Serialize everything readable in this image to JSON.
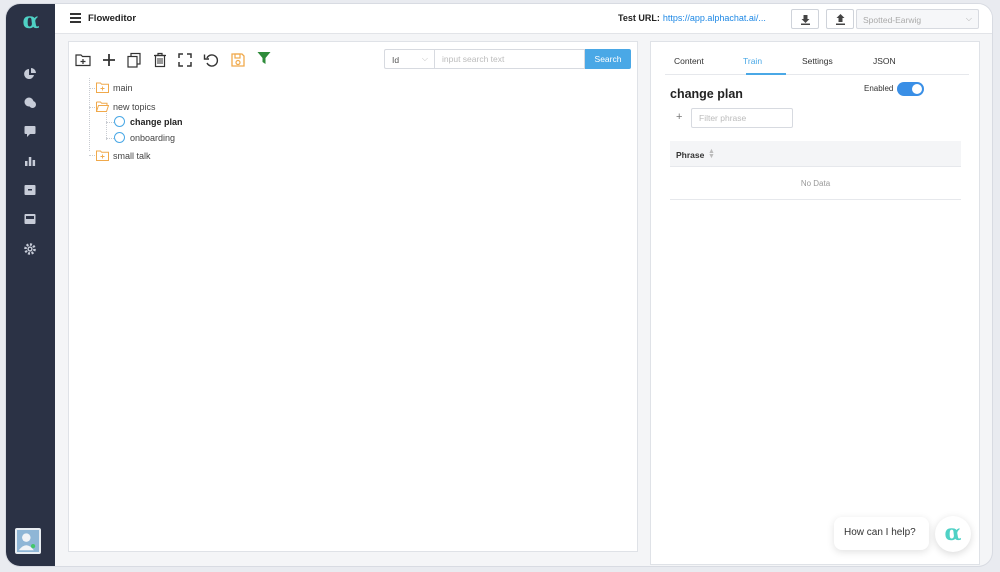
{
  "app": {
    "logo": "α",
    "title": "Floweditor"
  },
  "topbar": {
    "test_url_label": "Test URL:",
    "test_url_value": "https://app.alphachat.ai/...",
    "download_icon": "download-icon",
    "upload_icon": "upload-icon",
    "bot_select_value": "Spotted-Earwig"
  },
  "sidebar": {
    "items": [
      {
        "icon": "analytics-icon"
      },
      {
        "icon": "chat-icon"
      },
      {
        "icon": "message-icon"
      },
      {
        "icon": "bar-chart-icon"
      },
      {
        "icon": "archive-icon"
      },
      {
        "icon": "inbox-icon"
      },
      {
        "icon": "gear-icon"
      }
    ],
    "avatar_icon": "user-avatar-icon"
  },
  "toolbar": {
    "icons": [
      "new-folder-icon",
      "add-icon",
      "copy-icon",
      "trash-icon",
      "fullscreen-icon",
      "undo-icon",
      "save-icon",
      "filter-icon"
    ]
  },
  "search": {
    "type_value": "Id",
    "placeholder": "input search text",
    "button_label": "Search"
  },
  "tree": {
    "nodes": [
      {
        "label": "main",
        "type": "folder"
      },
      {
        "label": "new topics",
        "type": "folder-open"
      },
      {
        "label": "change plan",
        "type": "intent",
        "selected": true
      },
      {
        "label": "onboarding",
        "type": "intent"
      },
      {
        "label": "small talk",
        "type": "folder"
      }
    ]
  },
  "detail": {
    "tabs": [
      {
        "label": "Content"
      },
      {
        "label": "Train",
        "active": true
      },
      {
        "label": "Settings"
      },
      {
        "label": "JSON"
      }
    ],
    "title": "change plan",
    "enabled_label": "Enabled",
    "enabled": true,
    "add_symbol": "+",
    "filter_placeholder": "Filter phrase",
    "table": {
      "column_header": "Phrase",
      "empty_text": "No Data"
    }
  },
  "chat_widget": {
    "bubble_text": "How can I help?",
    "avatar_glyph": "α"
  },
  "colors": {
    "sidebar_bg": "#2b3245",
    "accent": "#4aa8e6",
    "toggle_on": "#3a8fe6",
    "folder": "#f0a94b",
    "filter_green": "#2e8b3a",
    "logo_teal": "#4fd1c5"
  }
}
